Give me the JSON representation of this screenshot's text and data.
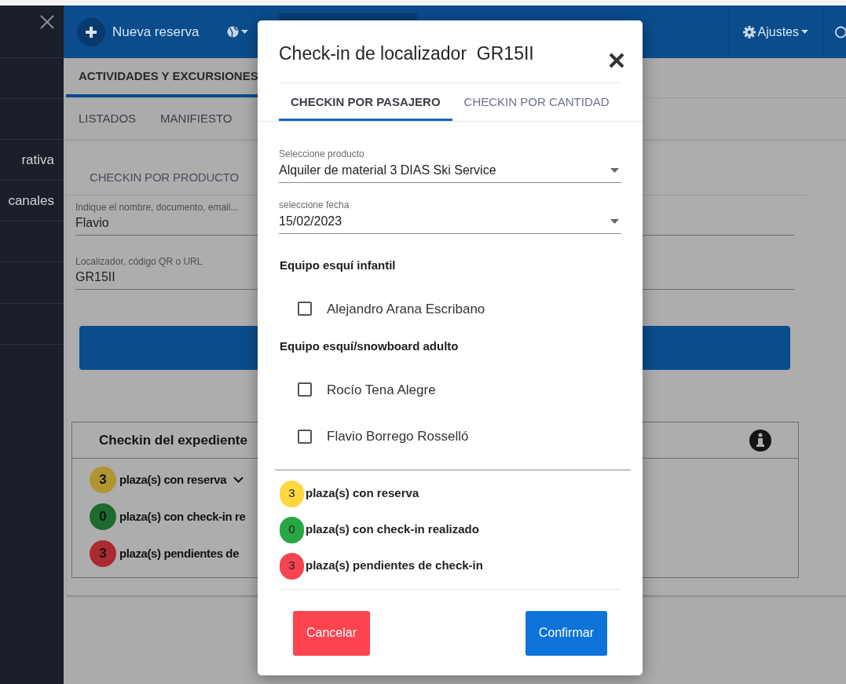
{
  "sidebar": {
    "items": [
      {
        "label": "rativa"
      },
      {
        "label": "canales"
      }
    ]
  },
  "top_bar": {
    "new_button": "Nueva reserva",
    "settings": "Ajustes"
  },
  "main_tabs": [
    {
      "label": "ACTIVIDADES Y EXCURSIONES",
      "selected": true
    }
  ],
  "sub_tabs": [
    {
      "label": "LISTADOS"
    },
    {
      "label": "MANIFIESTO"
    }
  ],
  "card": {
    "tab": "CHECKIN POR PRODUCTO",
    "fields": [
      {
        "label": "Indique el nombre, documento, email...",
        "value": "Flavio"
      },
      {
        "label": "Localizador, código QR o URL",
        "value": "GR15II"
      }
    ],
    "expediente": {
      "title": "Checkin del expediente",
      "rows": [
        {
          "count": "3",
          "text": "plaza(s) con reserva",
          "color": "#b09530",
          "kind": "dropdown"
        },
        {
          "count": "0",
          "text": "plaza(s) con check-in re",
          "color": "#1d6b2e",
          "kind": "plain"
        },
        {
          "count": "3",
          "text": "plaza(s) pendientes de",
          "color": "#ab2a30",
          "kind": "plain"
        }
      ]
    }
  },
  "modal": {
    "title": "Check-in de localizador  GR15II",
    "tabs": [
      {
        "label": "CHECKIN POR PASAJERO",
        "selected": true
      },
      {
        "label": "CHECKIN POR CANTIDAD",
        "selected": false
      }
    ],
    "selects": [
      {
        "label": "Seleccione producto",
        "value": "Alquiler de material 3 DIAS Ski Service"
      },
      {
        "label": "seleccione fecha",
        "value": "15/02/2023"
      }
    ],
    "groups": [
      {
        "title": "Equipo esquí infantil",
        "passengers": [
          {
            "name": "Alejandro Arana Escribano",
            "checked": false
          }
        ]
      },
      {
        "title": "Equipo esquí/snowboard adulto",
        "passengers": [
          {
            "name": "Rocío Tena Alegre",
            "checked": false
          },
          {
            "name": "Flavio Borrego Rosselló",
            "checked": false
          }
        ]
      }
    ],
    "summary": [
      {
        "count": "3",
        "text": "plaza(s) con reserva",
        "color": "#ffd740"
      },
      {
        "count": "0",
        "text": "plaza(s) con check-in realizado",
        "color": "#28a745"
      },
      {
        "count": "3",
        "text": "plaza(s) pendientes de check-in",
        "color": "#f54452"
      }
    ],
    "buttons": [
      {
        "label": "Cancelar",
        "kind": "cancel"
      },
      {
        "label": "Confirmar",
        "kind": "confirm"
      }
    ]
  }
}
